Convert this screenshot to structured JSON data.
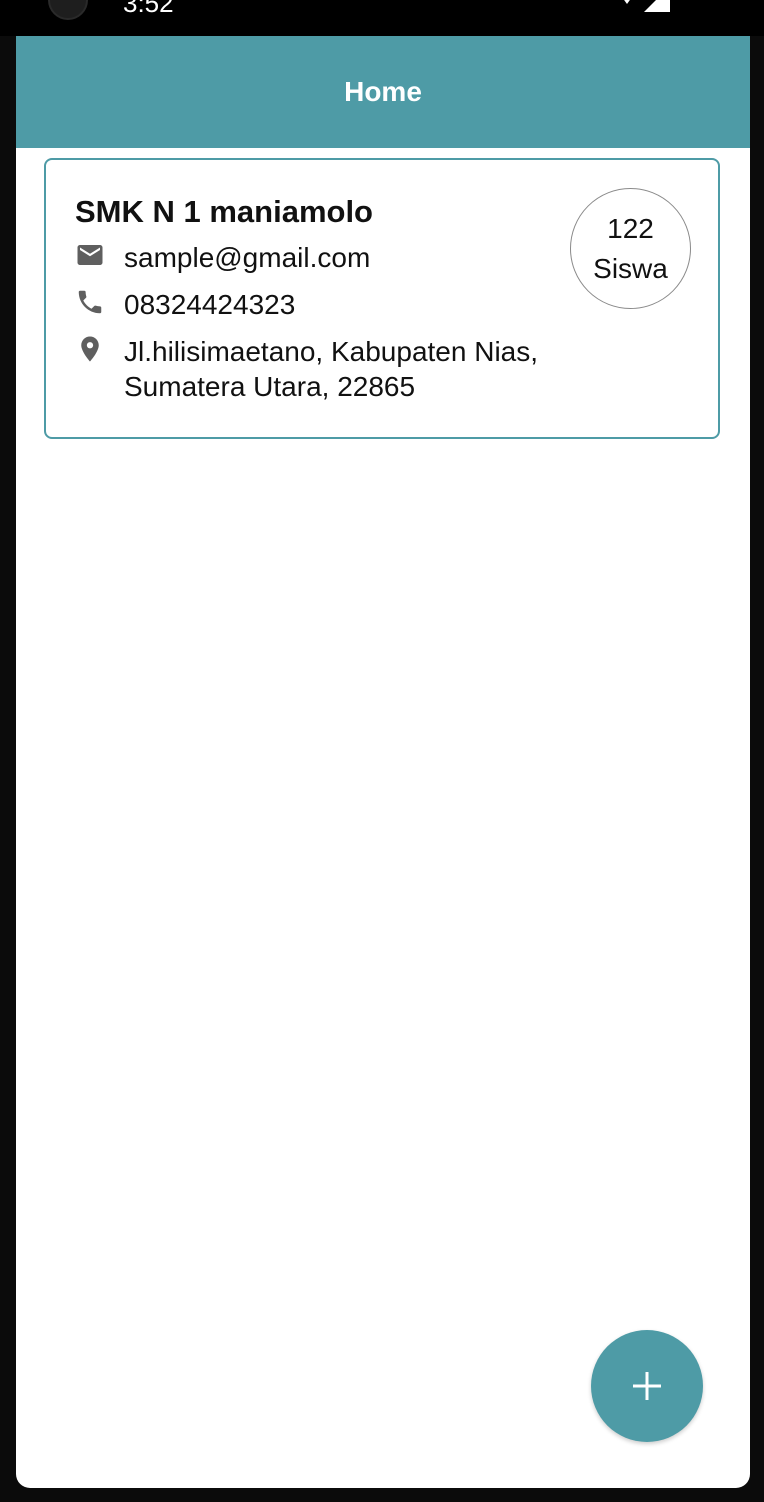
{
  "status_bar": {
    "time": "3:52",
    "icons": [
      "wifi-icon",
      "signal-icon"
    ]
  },
  "app_bar": {
    "title": "Home"
  },
  "school_card": {
    "name": "SMK N 1 maniamolo",
    "email": "sample@gmail.com",
    "phone": "08324424323",
    "address_line1": "Jl.hilisimaetano, Kabupaten Nias,",
    "address_line2": "Sumatera Utara, 22865",
    "student_count": "122",
    "student_label": "Siswa",
    "icons": {
      "email": "email-icon",
      "phone": "phone-icon",
      "address": "location-pin-icon"
    }
  },
  "fab": {
    "icon": "plus-icon"
  },
  "colors": {
    "primary": "#4e9ba6",
    "background": "#ffffff",
    "icon_gray": "#5f5f5f"
  }
}
